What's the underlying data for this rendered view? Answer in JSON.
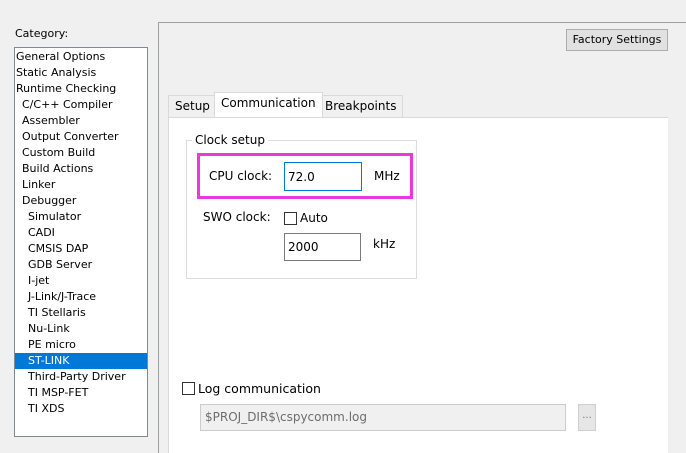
{
  "category": {
    "label": "Category:",
    "items": [
      "General Options",
      "Static Analysis",
      "Runtime Checking",
      "C/C++ Compiler",
      "Assembler",
      "Output Converter",
      "Custom Build",
      "Build Actions",
      "Linker",
      "Debugger",
      "Simulator",
      "CADI",
      "CMSIS DAP",
      "GDB Server",
      "I-jet",
      "J-Link/J-Trace",
      "TI Stellaris",
      "Nu-Link",
      "PE micro",
      "ST-LINK",
      "Third-Party Driver",
      "TI MSP-FET",
      "TI XDS"
    ],
    "selected": "ST-LINK"
  },
  "toolbar": {
    "factory_label": "Factory Settings"
  },
  "tabs": [
    "Setup",
    "Communication",
    "Breakpoints"
  ],
  "active_tab": "Communication",
  "clock_setup": {
    "group_label": "Clock setup",
    "cpu_label": "CPU clock:",
    "cpu_value": "72.0",
    "cpu_unit": "MHz",
    "swo_label": "SWO clock:",
    "auto_label": "Auto",
    "auto_checked": false,
    "swo_value": "2000",
    "swo_unit": "kHz"
  },
  "log": {
    "label": "Log communication",
    "checked": false,
    "path": "$PROJ_DIR$\\cspycomm.log",
    "browse_label": "..."
  },
  "colors": {
    "highlight": "#e838e0",
    "selection": "#0078d7"
  }
}
